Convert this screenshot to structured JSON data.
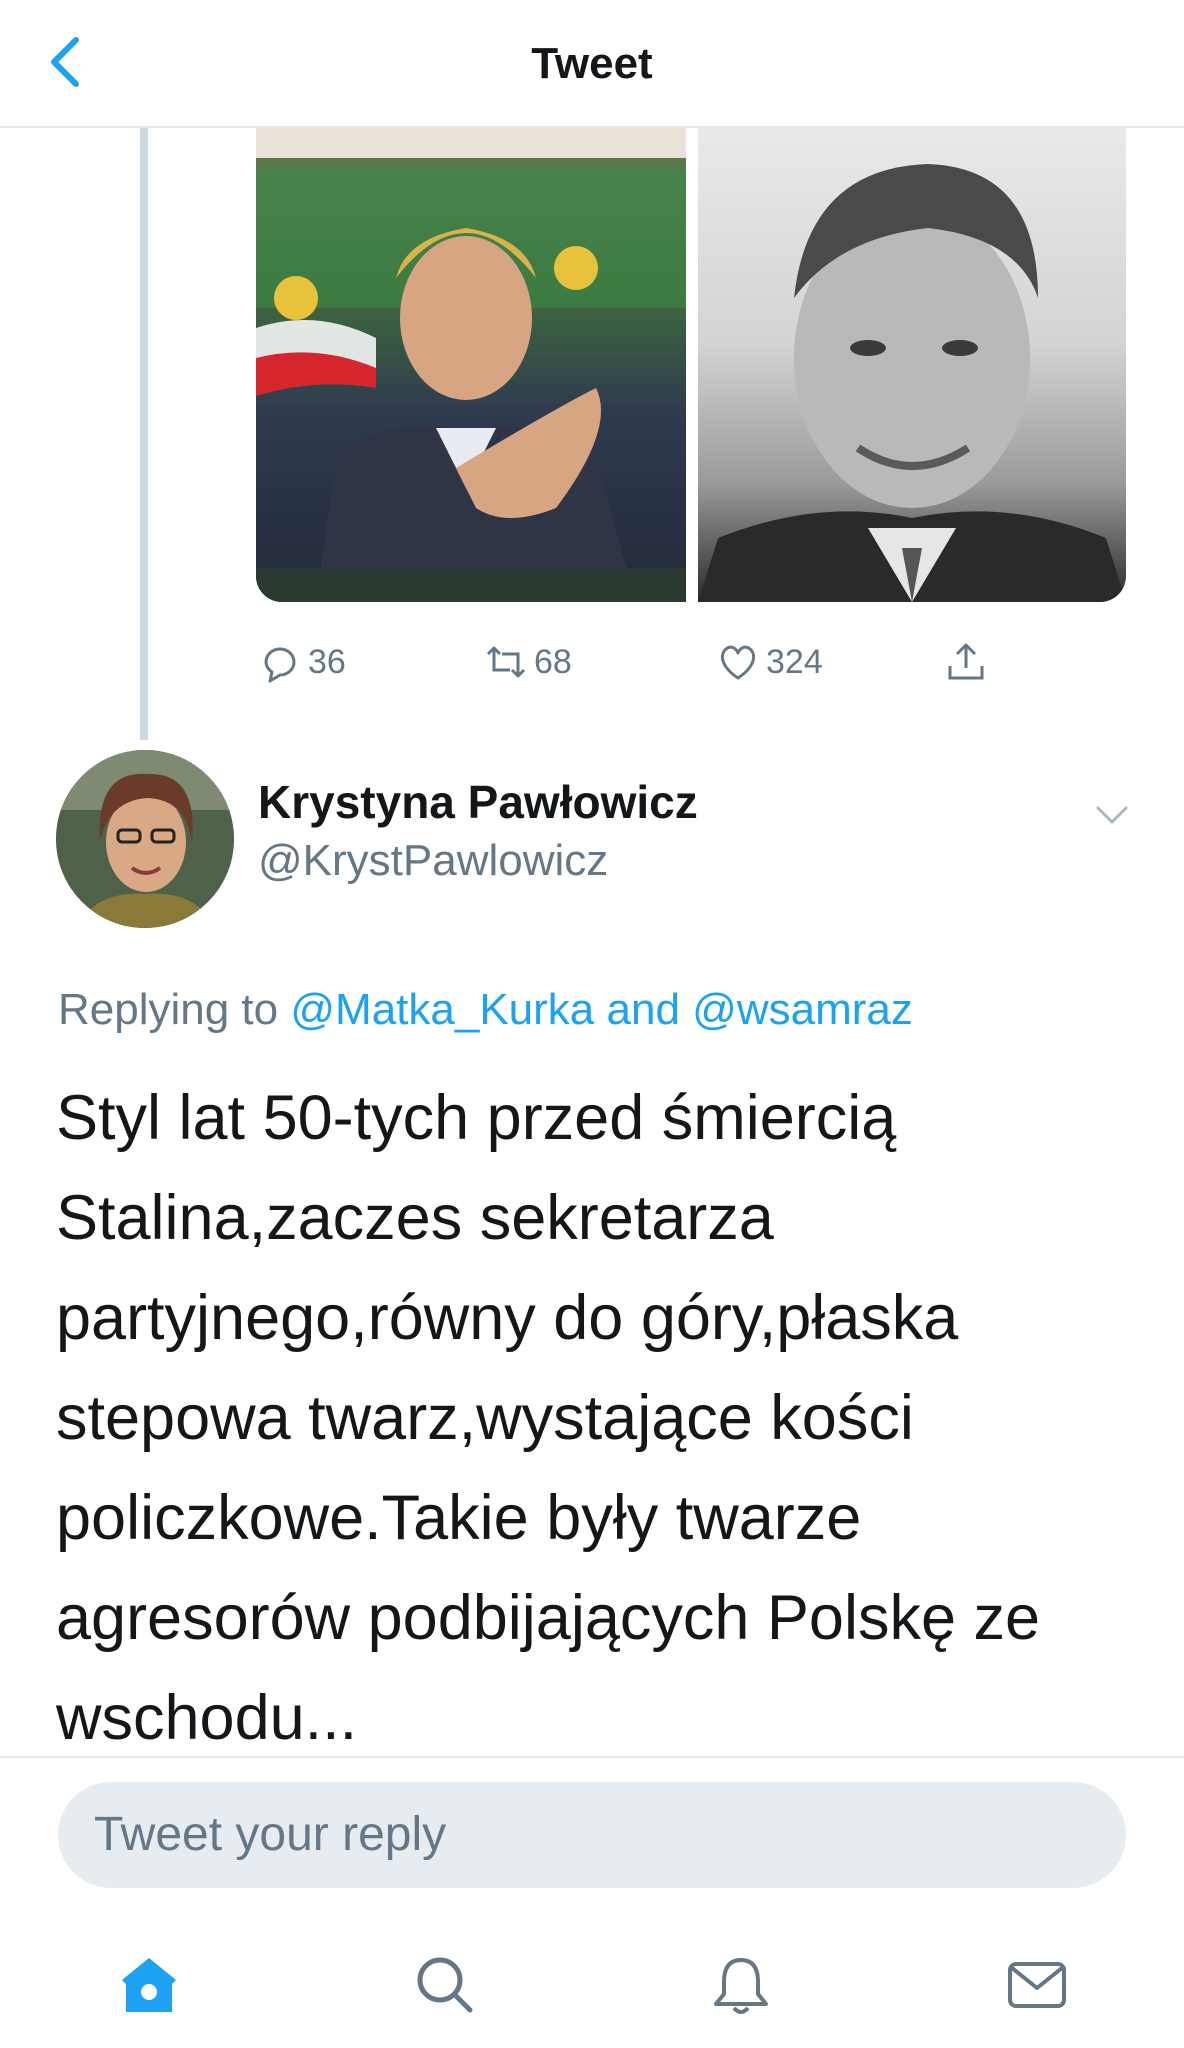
{
  "header": {
    "title": "Tweet",
    "back_icon": "chevron-left-icon"
  },
  "colors": {
    "accent": "#1da1f2",
    "text": "#14171a",
    "muted": "#657786",
    "border": "#e1e8ed",
    "reply_bg": "#e6ecf0"
  },
  "previous_tweet": {
    "actions": {
      "replies": "36",
      "retweets": "68",
      "likes": "324"
    }
  },
  "tweet": {
    "author_name": "Krystyna Pawłowicz",
    "author_handle": "@KrystPawlowicz",
    "replying_prefix": "Replying to",
    "replying_user1": "@Matka_Kurka",
    "replying_and": "and",
    "replying_user2": "@wsamraz",
    "text_lines": [
      "Styl lat 50-tych przed śmiercią",
      "Stalina,zaczes sekretarza",
      "partyjnego,równy do góry,płaska",
      "stepowa twarz,wystające kości",
      "policzkowe.Takie były twarze",
      "agresorów podbijających Polskę ze",
      "wschodu..."
    ]
  },
  "reply_input": {
    "placeholder": "Tweet your reply"
  },
  "tabbar": {
    "items": [
      "home-icon",
      "search-icon",
      "notifications-icon",
      "messages-icon"
    ]
  }
}
